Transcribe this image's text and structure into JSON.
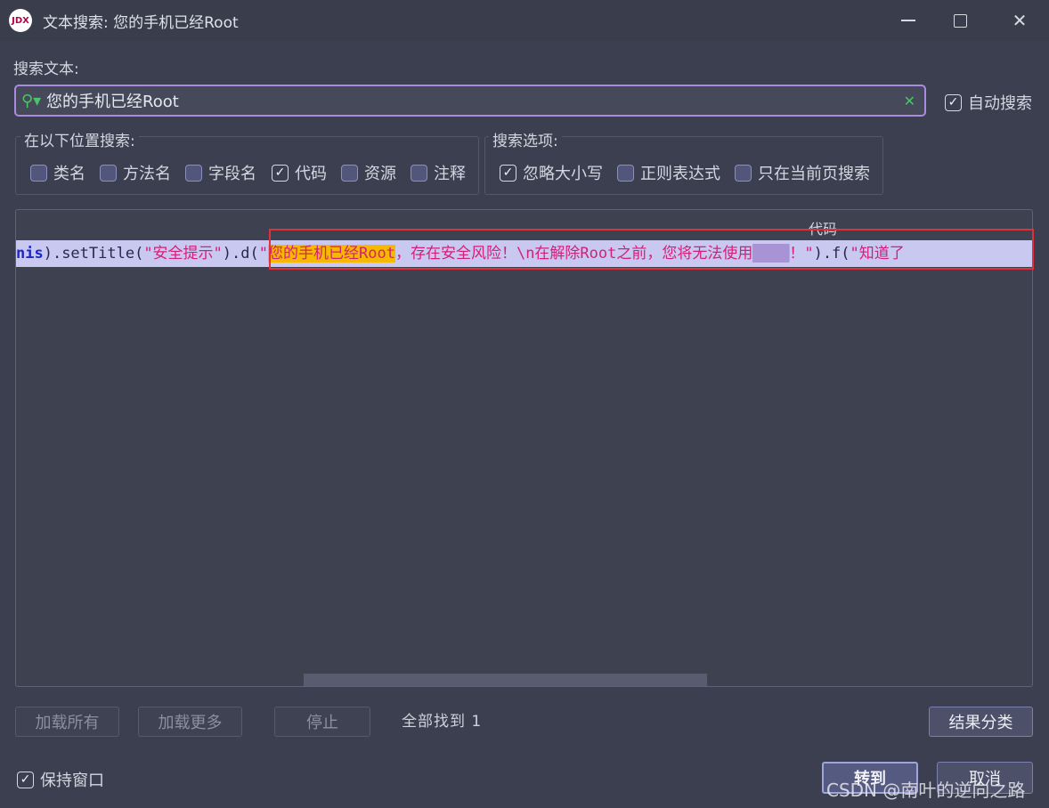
{
  "window": {
    "app_icon_text": "JDX",
    "title": "文本搜索: 您的手机已经Root"
  },
  "search": {
    "label": "搜索文本:",
    "value": "您的手机已经Root",
    "auto_search_label": "自动搜索",
    "auto_search_checked": true
  },
  "search_in": {
    "title": "在以下位置搜索:",
    "options": [
      {
        "label": "类名",
        "checked": false
      },
      {
        "label": "方法名",
        "checked": false
      },
      {
        "label": "字段名",
        "checked": false
      },
      {
        "label": "代码",
        "checked": true
      },
      {
        "label": "资源",
        "checked": false
      },
      {
        "label": "注释",
        "checked": false
      }
    ]
  },
  "search_options": {
    "title": "搜索选项:",
    "options": [
      {
        "label": "忽略大小写",
        "checked": true
      },
      {
        "label": "正则表达式",
        "checked": false
      },
      {
        "label": "只在当前页搜索",
        "checked": false
      }
    ]
  },
  "results": {
    "column_header": "代码",
    "rows": [
      {
        "code": {
          "kw": "nis",
          "p1": ").setTitle(",
          "s1": "\"安全提示\"",
          "p2": ").d(",
          "s2_open": "\"",
          "match": "您的手机已经Root",
          "s2_rest": "，存在安全风险！\\n在解除Root之前，您将无法使用",
          "masked": "████",
          "s2_end": "！\"",
          "p3": ").f(",
          "s3": "\"知道了"
        }
      }
    ]
  },
  "buttons": {
    "load_all": "加载所有",
    "load_more": "加载更多",
    "stop": "停止",
    "found_text": "全部找到 1",
    "group_results": "结果分类",
    "goto": "转到",
    "cancel": "取消"
  },
  "keep_window": {
    "label": "保持窗口",
    "checked": true
  },
  "watermark": "CSDN @南叶的逆向之路"
}
